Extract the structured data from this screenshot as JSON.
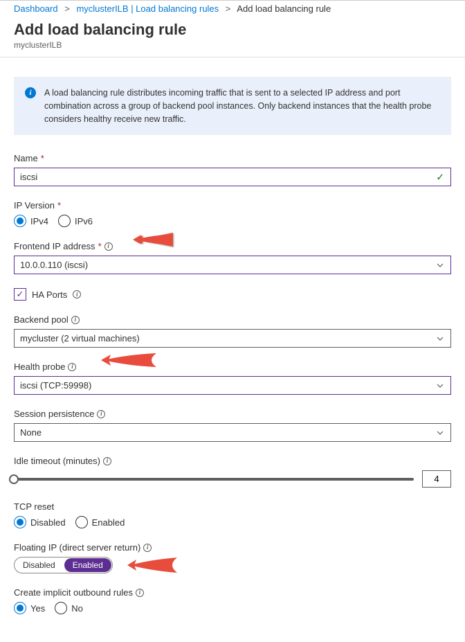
{
  "breadcrumb": {
    "items": [
      "Dashboard",
      "myclusterILB | Load balancing rules",
      "Add load balancing rule"
    ]
  },
  "header": {
    "title": "Add load balancing rule",
    "subtitle": "myclusterILB"
  },
  "info": {
    "text": "A load balancing rule distributes incoming traffic that is sent to a selected IP address and port combination across a group of backend pool instances. Only backend instances that the health probe considers healthy receive new traffic."
  },
  "fields": {
    "name": {
      "label": "Name",
      "value": "iscsi"
    },
    "ipversion": {
      "label": "IP Version",
      "options": [
        "IPv4",
        "IPv6"
      ],
      "selected": "IPv4"
    },
    "frontend": {
      "label": "Frontend IP address",
      "value": "10.0.0.110 (iscsi)"
    },
    "haports": {
      "label": "HA Ports",
      "checked": true
    },
    "backend": {
      "label": "Backend pool",
      "value": "mycluster (2 virtual machines)"
    },
    "probe": {
      "label": "Health probe",
      "value": "iscsi (TCP:59998)"
    },
    "session": {
      "label": "Session persistence",
      "value": "None"
    },
    "idle": {
      "label": "Idle timeout (minutes)",
      "value": "4"
    },
    "tcpreset": {
      "label": "TCP reset",
      "options": [
        "Disabled",
        "Enabled"
      ],
      "selected": "Disabled"
    },
    "floatingip": {
      "label": "Floating IP (direct server return)",
      "options": [
        "Disabled",
        "Enabled"
      ],
      "selected": "Enabled"
    },
    "outbound": {
      "label": "Create implicit outbound rules",
      "options": [
        "Yes",
        "No"
      ],
      "selected": "Yes"
    }
  }
}
